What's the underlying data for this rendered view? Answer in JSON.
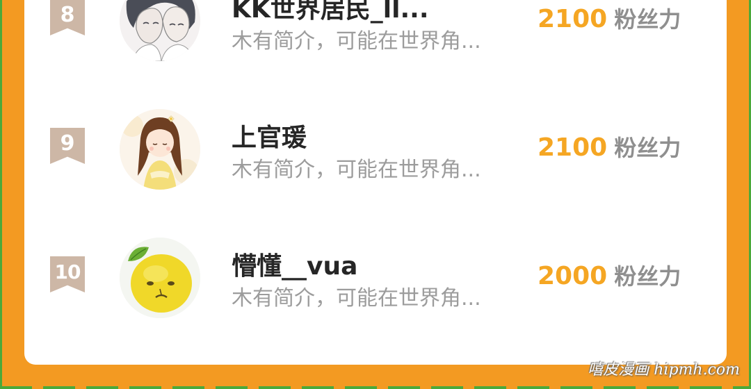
{
  "ranking": {
    "items": [
      {
        "rank": "8",
        "name": "KK世界居民_ll...",
        "bio": "木有简介，可能在世界角...",
        "score": "2100",
        "score_unit": "粉丝力",
        "avatar_icon": "anime-couple-avatar"
      },
      {
        "rank": "9",
        "name": "上官瑗",
        "bio": "木有简介，可能在世界角...",
        "score": "2100",
        "score_unit": "粉丝力",
        "avatar_icon": "anime-girl-avatar"
      },
      {
        "rank": "10",
        "name": "懵懂__vua",
        "bio": "木有简介，可能在世界角...",
        "score": "2000",
        "score_unit": "粉丝力",
        "avatar_icon": "lemon-face-avatar"
      }
    ]
  },
  "watermark": "嘻皮漫画 hipmh.com",
  "colors": {
    "frame": "#F39A22",
    "score": "#F5A623",
    "rank_badge": "#CDB7A6",
    "edge_green": "#4BA93A"
  }
}
